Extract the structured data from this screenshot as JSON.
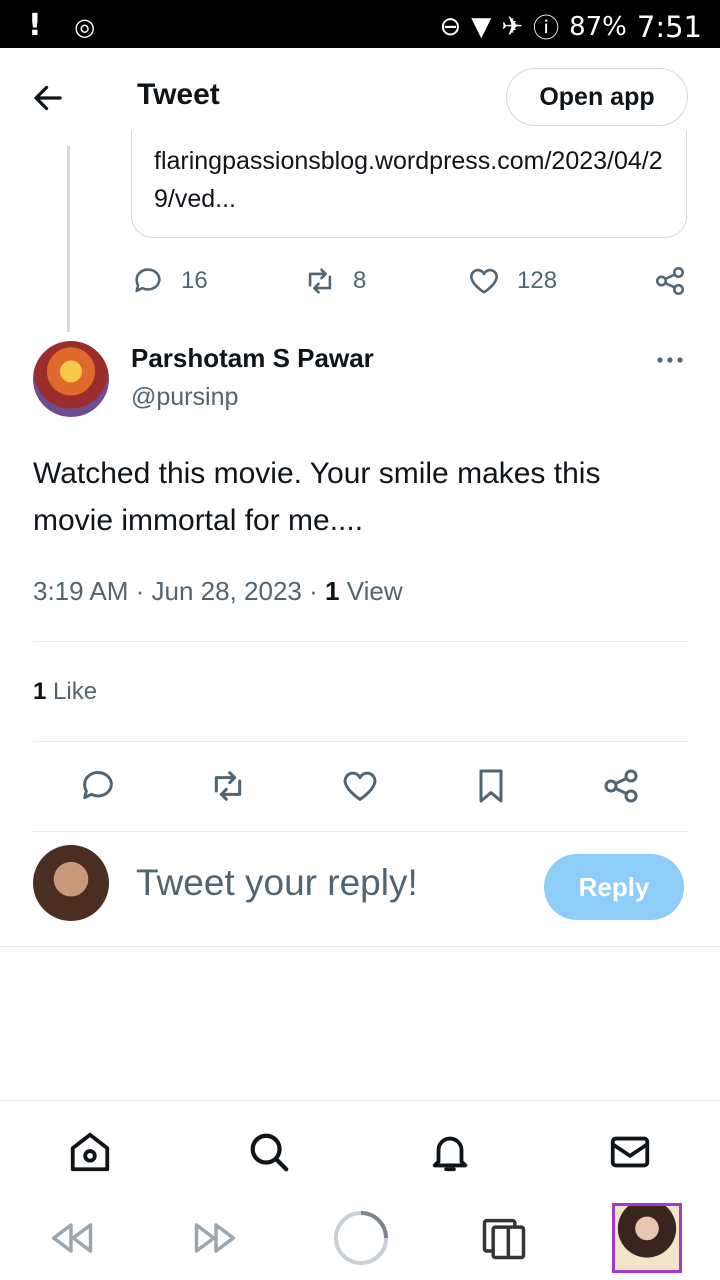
{
  "status_bar": {
    "left_icons": [
      "notification-icon",
      "media-icon"
    ],
    "battery": "87%",
    "time": "7:51"
  },
  "header": {
    "title": "Tweet",
    "open_app_label": "Open app"
  },
  "quoted_card": {
    "link_text": "flaringpassionsblog.wordpress.com/2023/04/29/ved..."
  },
  "parent_actions": {
    "replies": "16",
    "retweets": "8",
    "likes": "128"
  },
  "tweet": {
    "author_name": "Parshotam S Pawar",
    "author_handle": "@pursinp",
    "text": "Watched this movie. Your smile makes this movie immortal for me....",
    "time": "3:19 AM",
    "date": "Jun 28, 2023",
    "views_count": "1",
    "views_label": "View",
    "likes_count": "1",
    "likes_label": "Like"
  },
  "reply_box": {
    "placeholder": "Tweet your reply!",
    "button_label": "Reply"
  },
  "colors": {
    "accent": "#1d9bf0",
    "reply_button_disabled": "#8ecdf8",
    "secondary_text": "#536471",
    "border": "#cfd9de"
  }
}
